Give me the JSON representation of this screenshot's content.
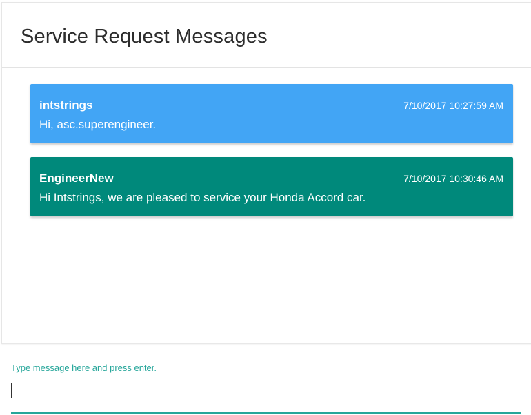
{
  "header": {
    "title": "Service Request Messages"
  },
  "messages": [
    {
      "sender": "intstrings",
      "timestamp": "7/10/2017 10:27:59 AM",
      "text": "Hi, asc.superengineer.",
      "color": "#42a5f5"
    },
    {
      "sender": "EngineerNew",
      "timestamp": "7/10/2017 10:30:46 AM",
      "text": "Hi Intstrings, we are pleased to service your Honda Accord car.",
      "color": "#00897b"
    }
  ],
  "input": {
    "label": "Type message here and press enter.",
    "value": "",
    "accent_color": "#26a69a"
  }
}
